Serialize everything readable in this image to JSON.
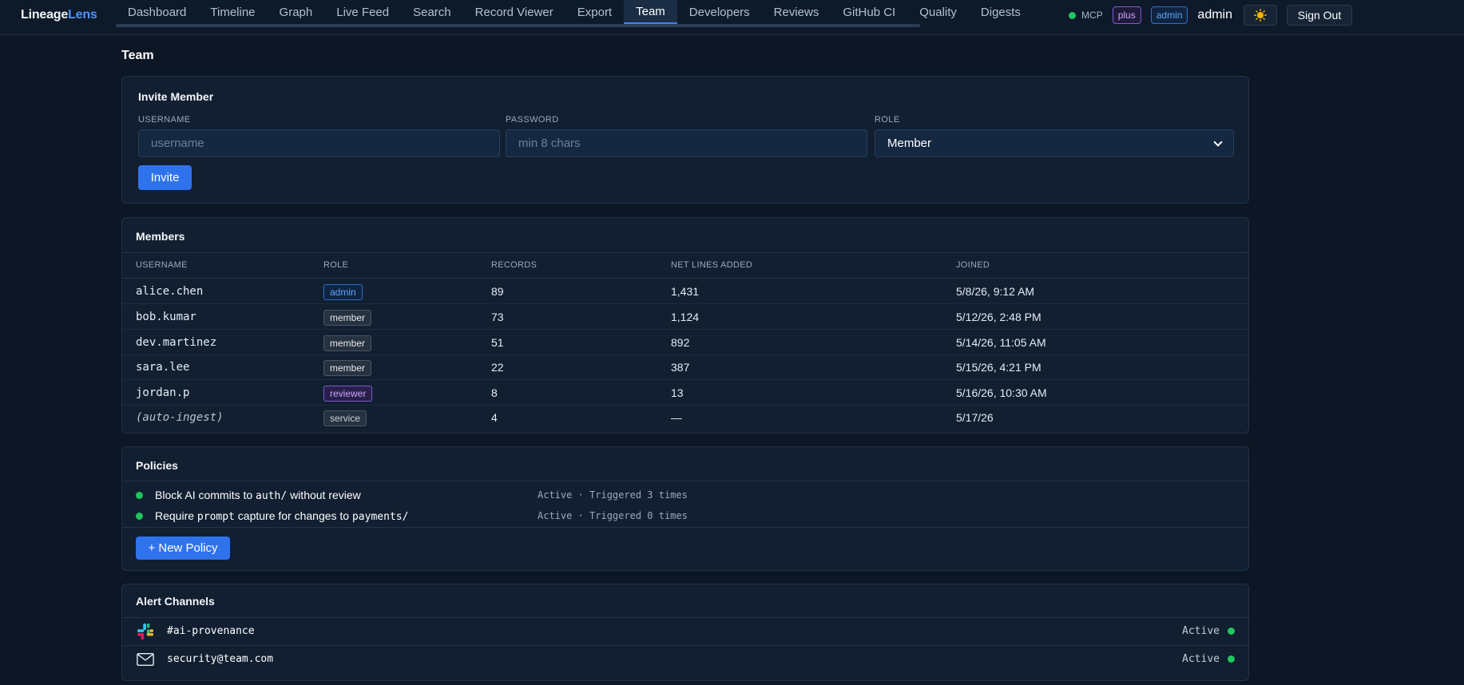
{
  "app": {
    "logo_part1": "Lineage",
    "logo_part2": "Lens"
  },
  "nav": {
    "items": [
      "Dashboard",
      "Timeline",
      "Graph",
      "Live Feed",
      "Search",
      "Record Viewer",
      "Export",
      "Team",
      "Developers",
      "Reviews",
      "GitHub CI",
      "Quality",
      "Digests"
    ],
    "active": "Team"
  },
  "header": {
    "mcp_label": "MCP",
    "plan_badge": "plus",
    "role_badge": "admin",
    "username": "admin",
    "theme_icon": "sun-icon",
    "signout_label": "Sign Out"
  },
  "page": {
    "title": "Team"
  },
  "invite": {
    "title": "Invite Member",
    "username_label": "USERNAME",
    "username_placeholder": "username",
    "password_label": "PASSWORD",
    "password_placeholder": "min 8 chars",
    "role_label": "ROLE",
    "role_value": "Member",
    "submit_label": "Invite"
  },
  "members": {
    "title": "Members",
    "columns": [
      "USERNAME",
      "ROLE",
      "RECORDS",
      "NET LINES ADDED",
      "JOINED"
    ],
    "rows": [
      {
        "username": "alice.chen",
        "role": "admin",
        "records": "89",
        "lines": "1,431",
        "joined": "5/8/26, 9:12 AM"
      },
      {
        "username": "bob.kumar",
        "role": "member",
        "records": "73",
        "lines": "1,124",
        "joined": "5/12/26, 2:48 PM"
      },
      {
        "username": "dev.martinez",
        "role": "member",
        "records": "51",
        "lines": "892",
        "joined": "5/14/26, 11:05 AM"
      },
      {
        "username": "sara.lee",
        "role": "member",
        "records": "22",
        "lines": "387",
        "joined": "5/15/26, 4:21 PM"
      },
      {
        "username": "jordan.p",
        "role": "reviewer",
        "records": "8",
        "lines": "13",
        "joined": "5/16/26, 10:30 AM"
      },
      {
        "username": "(auto-ingest)",
        "role": "service",
        "records": "4",
        "lines": "—",
        "joined": "5/17/26"
      }
    ]
  },
  "policies": {
    "title": "Policies",
    "items": [
      {
        "prefix": "Block AI commits to ",
        "code": "auth/",
        "suffix": " without review",
        "status": "Active · Triggered 3 times"
      },
      {
        "prefix": "Require ",
        "code": "prompt",
        "middle": " capture for changes to ",
        "code2": "payments/",
        "status": "Active · Triggered 0 times"
      }
    ],
    "new_label": "+ New Policy"
  },
  "alerts": {
    "title": "Alert Channels",
    "channels": [
      {
        "icon": "slack-icon",
        "name": "#ai-provenance",
        "status": "Active"
      },
      {
        "icon": "mail-icon",
        "name": "security@team.com",
        "status": "Active"
      }
    ]
  },
  "colors": {
    "accent": "#2f73ec",
    "status_active": "#22c55e",
    "background": "#0c1624"
  }
}
